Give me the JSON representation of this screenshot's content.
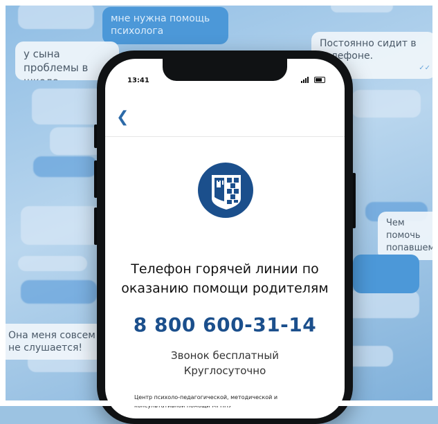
{
  "background_bubbles": [
    {
      "text": "мне нужна помощь психолога",
      "style": "blue"
    },
    {
      "text": "у сына проблемы в школе...",
      "style": "white"
    },
    {
      "text": "Постоянно сидит в телефоне.",
      "style": "white"
    },
    {
      "text": "Чем помочь попавшему в ситуацию?",
      "style": "white"
    },
    {
      "text": "Она меня совсем не слушается!",
      "style": "white"
    }
  ],
  "status_bar": {
    "time": "13:41"
  },
  "navigation": {
    "back_icon": "chevron-left-icon"
  },
  "content": {
    "title_line1": "Телефон горячей линии по",
    "title_line2": "оказанию помощи родителям",
    "phone_number": "8 800 600-31-14",
    "subtitle_line1": "Звонок бесплатный",
    "subtitle_line2": "Круглосуточно",
    "footer_line1": "Центр психоло-педагогической, методической и",
    "footer_line2": "консультативной помощи МГППУ"
  },
  "colors": {
    "brand_blue": "#1b4f8c",
    "bubble_blue": "#4c98d8",
    "background": "#9cc3e2"
  }
}
